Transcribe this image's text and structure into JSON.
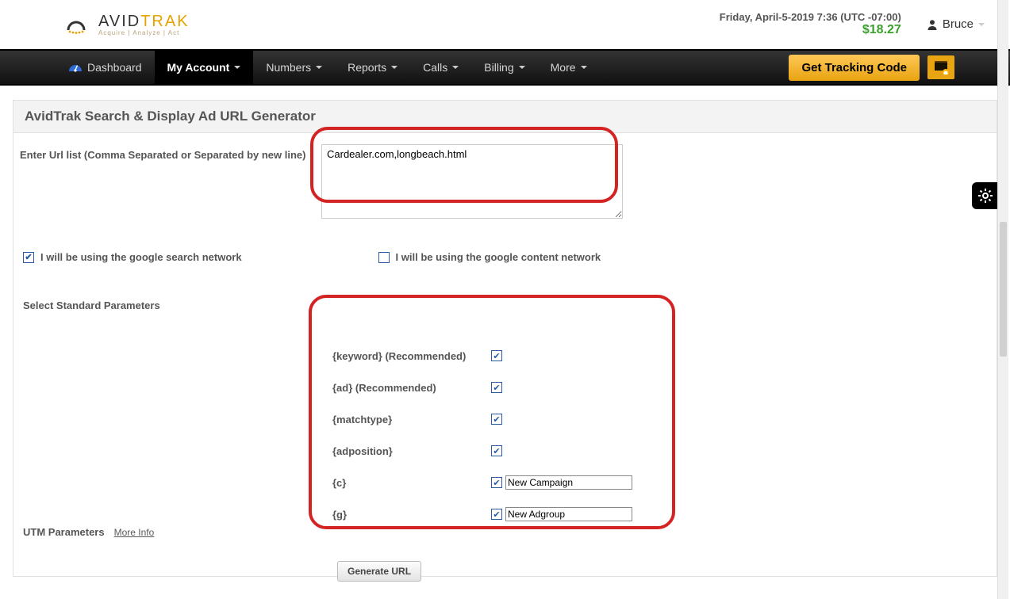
{
  "header": {
    "logo_brand_a": "AVID",
    "logo_brand_b": "TRAK",
    "logo_tag": "Acquire | Analyze | Act",
    "date": "Friday, April-5-2019 7:36 (UTC -07:00)",
    "balance": "$18.27",
    "user": "Bruce"
  },
  "nav": {
    "dashboard": "Dashboard",
    "my_account": "My Account",
    "numbers": "Numbers",
    "reports": "Reports",
    "calls": "Calls",
    "billing": "Billing",
    "more": "More",
    "tracking_btn": "Get Tracking Code"
  },
  "page": {
    "title": "AvidTrak Search & Display Ad URL Generator",
    "url_label": "Enter Url list (Comma Separated or Separated by new line)",
    "url_value": "Cardealer.com,longbeach.html",
    "chk_search": "I will be using the google search network",
    "chk_content": "I will be using the google content network",
    "section_params": "Select Standard Parameters",
    "params": {
      "keyword": "{keyword} (Recommended)",
      "ad": "{ad} (Recommended)",
      "matchtype": "{matchtype}",
      "adposition": "{adposition}",
      "c": "{c}",
      "g": "{g}",
      "c_val": "New Campaign",
      "g_val": "New Adgroup"
    },
    "utm_label": "UTM Parameters",
    "utm_link": "More Info",
    "generate_btn": "Generate URL"
  }
}
